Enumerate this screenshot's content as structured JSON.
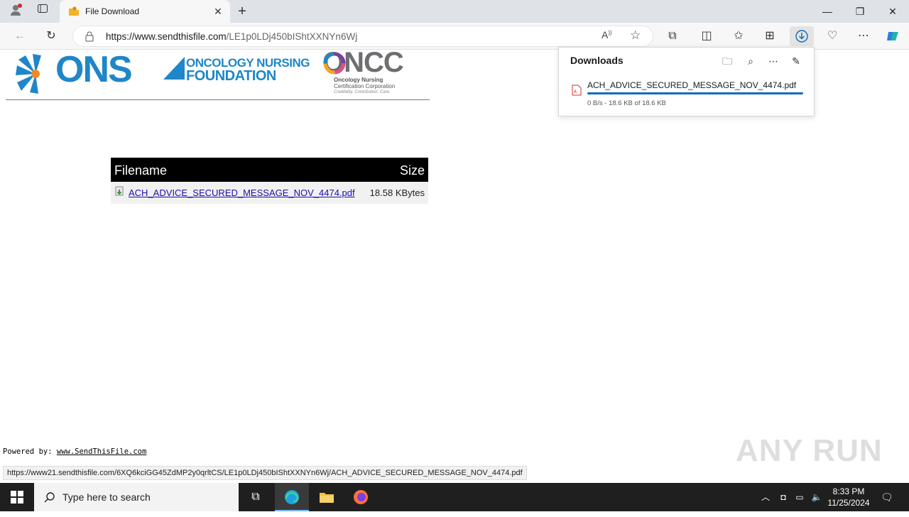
{
  "browser": {
    "tab_title": "File Download",
    "url_domain": "https://www.sendthisfile.com",
    "url_path": "/LE1p0LDj450bIShtXXNYn6Wj"
  },
  "page": {
    "logos": {
      "ons": "ONS",
      "foundation_line1": "ONCOLOGY NURSING",
      "foundation_line2": "FOUNDATION",
      "oncc": "ONCC",
      "oncc_sub1": "Oncology Nursing",
      "oncc_sub2": "Certification Corporation",
      "oncc_tagline": "Credibility. Contribution. Care."
    },
    "table": {
      "header_filename": "Filename",
      "header_size": "Size",
      "file_name": "ACH_ADVICE_SECURED_MESSAGE_NOV_4474.pdf",
      "file_size": "18.58 KBytes"
    },
    "powered_label": "Powered by:",
    "powered_link": "www.SendThisFile.com",
    "status_url": "https://www21.sendthisfile.com/6XQ6kciGG45ZdMP2y0qrltCS/LE1p0LDj450bIShtXXNYn6Wj/ACH_ADVICE_SECURED_MESSAGE_NOV_4474.pdf"
  },
  "downloads": {
    "title": "Downloads",
    "file_name": "ACH_ADVICE_SECURED_MESSAGE_NOV_4474.pdf",
    "meta": "0 B/s - 18.6 KB of 18.6 KB",
    "progress": 1.0
  },
  "watermark": "ANY RUN",
  "taskbar": {
    "search_placeholder": "Type here to search",
    "time": "8:33 PM",
    "date": "11/25/2024"
  },
  "colors": {
    "accent": "#0f6cbd",
    "ons_blue": "#1f86c8",
    "ons_orange": "#f08a24"
  }
}
